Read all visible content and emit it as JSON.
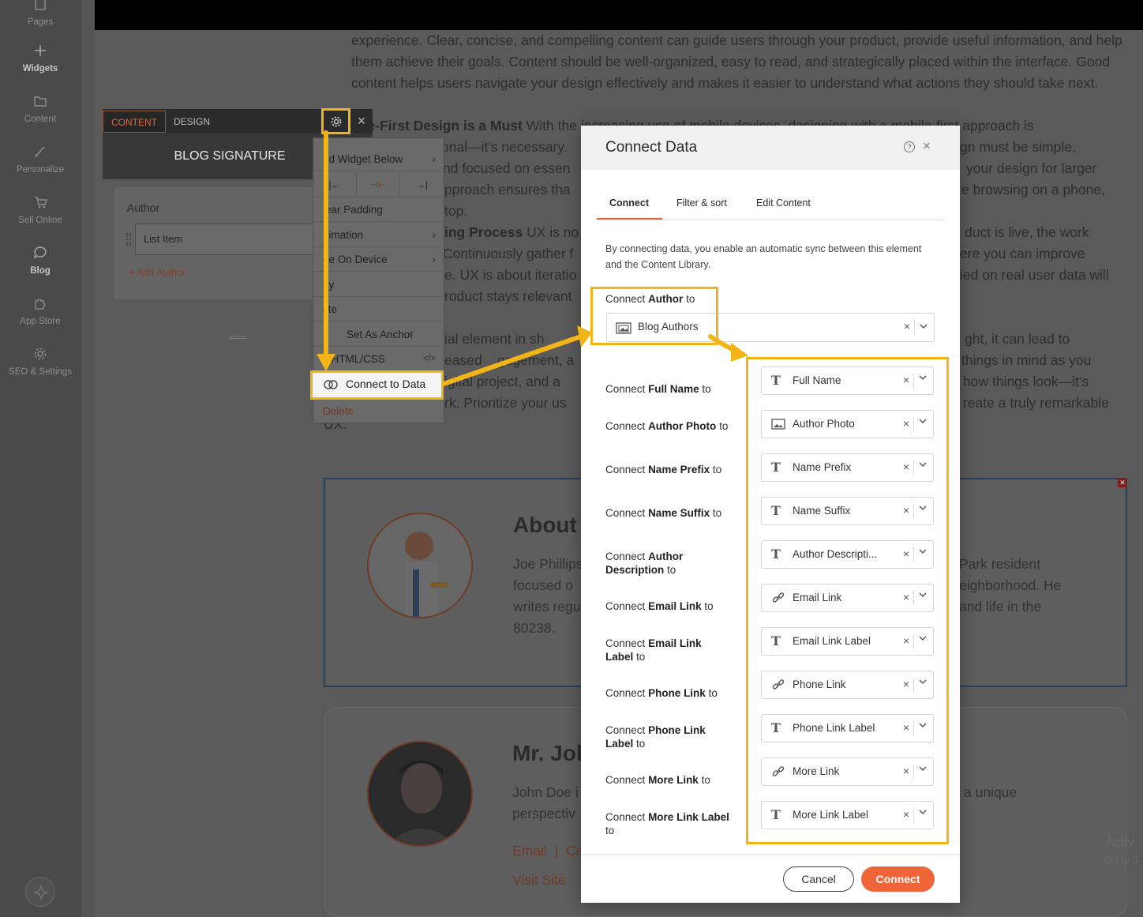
{
  "sidebar": {
    "items": [
      {
        "label": "Pages",
        "icon": "pages-icon"
      },
      {
        "label": "Widgets",
        "icon": "plus-icon"
      },
      {
        "label": "Content",
        "icon": "folder-icon"
      },
      {
        "label": "Personalize",
        "icon": "personalize-icon"
      },
      {
        "label": "Sell Online",
        "icon": "cart-icon"
      },
      {
        "label": "Blog",
        "icon": "chat-bubble-icon"
      },
      {
        "label": "App Store",
        "icon": "puzzle-icon"
      },
      {
        "label": "SEO & Settings",
        "icon": "gear-icon"
      }
    ]
  },
  "background_page": {
    "para1": "experience. Clear, concise, and compelling content can guide users through your product, provide useful information, and help them achieve their goals. Content should be well-organized, easy to read, and strategically placed within the interface. Good content helps users navigate your design effectively and makes it easier to understand what actions they should take next.",
    "para2_bold": "bile-First Design is a Must",
    "para2_a": "Wit",
    "para2_b": "h the increasing use of mobile devices, designing with a mobile-first approach is",
    "line_a": "onal—it's necessary.",
    "line_a_r": "gn must be simple,",
    "line_b": "nd focused on essen",
    "line_b_r": "your design for larger",
    "line_c": "pproach ensures tha",
    "line_c_r": "e browsing on a phone,",
    "line_d": "top.",
    "line_e_bold": "ing Process",
    "line_e": "UX is no",
    "line_e_r": "duct is live, the work",
    "line_f": "Continuously gather f",
    "line_f_r": "ere you can improve",
    "line_g": "e. UX is about iteratio",
    "line_g_r": "ied on real user data will",
    "line_h": "roduct stays relevant",
    "line_i": "ial element in sh",
    "line_i_r": "ght, it can lead to",
    "line_j": "eased",
    "line_j_m": "gagement, a",
    "line_j_r": "things in mind as you",
    "line_k": "igital project, and a",
    "line_k_r": "how things look—it's",
    "line_l": "rk. Prioritize your us",
    "line_l_r": "reate a truly remarkable",
    "line_m": "UX.",
    "card1_title": "About",
    "card1_l1": "Joe Phillips",
    "card1_l1_r": "Park resident",
    "card1_l2": "focused o",
    "card1_l2_r": "eighborhood. He",
    "card1_l3": "writes regu",
    "card1_l3_r": "and life in the",
    "card1_l4": "80238.",
    "card2_title": "Mr. Joh",
    "card2_l1": "John Doe i",
    "card2_l1_r": "a unique",
    "card2_l2": "perspectiv",
    "card2_email": "Email",
    "card2_pipe": "|",
    "card2_c": "Ca",
    "card2_visit": "Visit Site",
    "watermark": "Activ",
    "watermark2": "Go to S"
  },
  "panel": {
    "tabs": [
      "CONTENT",
      "DESIGN"
    ],
    "title": "BLOG SIGNATURE",
    "author_label": "Author",
    "list_item": "List Item",
    "add_author": "+ Add Author"
  },
  "context_menu": {
    "items": [
      {
        "label": "dd Widget Below",
        "chevron": true
      },
      {
        "label": "lear Padding",
        "chevron": false
      },
      {
        "label": "nimation",
        "chevron": true
      },
      {
        "label": "de On Device",
        "chevron": true
      },
      {
        "label": "py",
        "chevron": false
      },
      {
        "label": "ste",
        "chevron": false
      },
      {
        "label": "Set As Anchor",
        "chevron": false
      },
      {
        "label": "it HTML/CSS",
        "chevron": false
      }
    ],
    "padding_buttons": [
      "|←",
      "⊣⊢",
      "→|"
    ],
    "connect_label": "Connect to Data",
    "delete_label": "Delete"
  },
  "modal": {
    "title": "Connect Data",
    "tabs": [
      "Connect",
      "Filter & sort",
      "Edit Content"
    ],
    "description": "By connecting data, you enable an automatic sync between this element and the Content Library.",
    "author_connect_prefix": "Connect",
    "author_connect_bold": "Author",
    "author_connect_suffix": "to",
    "author_source": "Blog Authors",
    "fields": [
      {
        "prefix": "Connect",
        "bold": "Full Name",
        "suffix": "to",
        "value": "Full Name",
        "type": "text"
      },
      {
        "prefix": "Connect",
        "bold": "Author Photo",
        "suffix": "to",
        "value": "Author Photo",
        "type": "image"
      },
      {
        "prefix": "Connect",
        "bold": "Name Prefix",
        "suffix": "to",
        "value": "Name Prefix",
        "type": "text"
      },
      {
        "prefix": "Connect",
        "bold": "Name Suffix",
        "suffix": "to",
        "value": "Name Suffix",
        "type": "text"
      },
      {
        "prefix": "Connect",
        "bold": "Author Description",
        "suffix": "to",
        "value": "Author Descripti...",
        "type": "text"
      },
      {
        "prefix": "Connect",
        "bold": "Email Link",
        "suffix": "to",
        "value": "Email Link",
        "type": "link"
      },
      {
        "prefix": "Connect",
        "bold": "Email Link Label",
        "suffix": "to",
        "value": "Email Link Label",
        "type": "text"
      },
      {
        "prefix": "Connect",
        "bold": "Phone Link",
        "suffix": "to",
        "value": "Phone Link",
        "type": "link"
      },
      {
        "prefix": "Connect",
        "bold": "Phone Link Label",
        "suffix": "to",
        "value": "Phone Link Label",
        "type": "text"
      },
      {
        "prefix": "Connect",
        "bold": "More Link",
        "suffix": "to",
        "value": "More Link",
        "type": "link"
      },
      {
        "prefix": "Connect",
        "bold": "More Link Label",
        "suffix": "to",
        "value": "More Link Label",
        "type": "text"
      }
    ],
    "cancel_label": "Cancel",
    "connect_label": "Connect"
  },
  "colors": {
    "highlight": "#f2b417",
    "accent": "#f0643a"
  }
}
